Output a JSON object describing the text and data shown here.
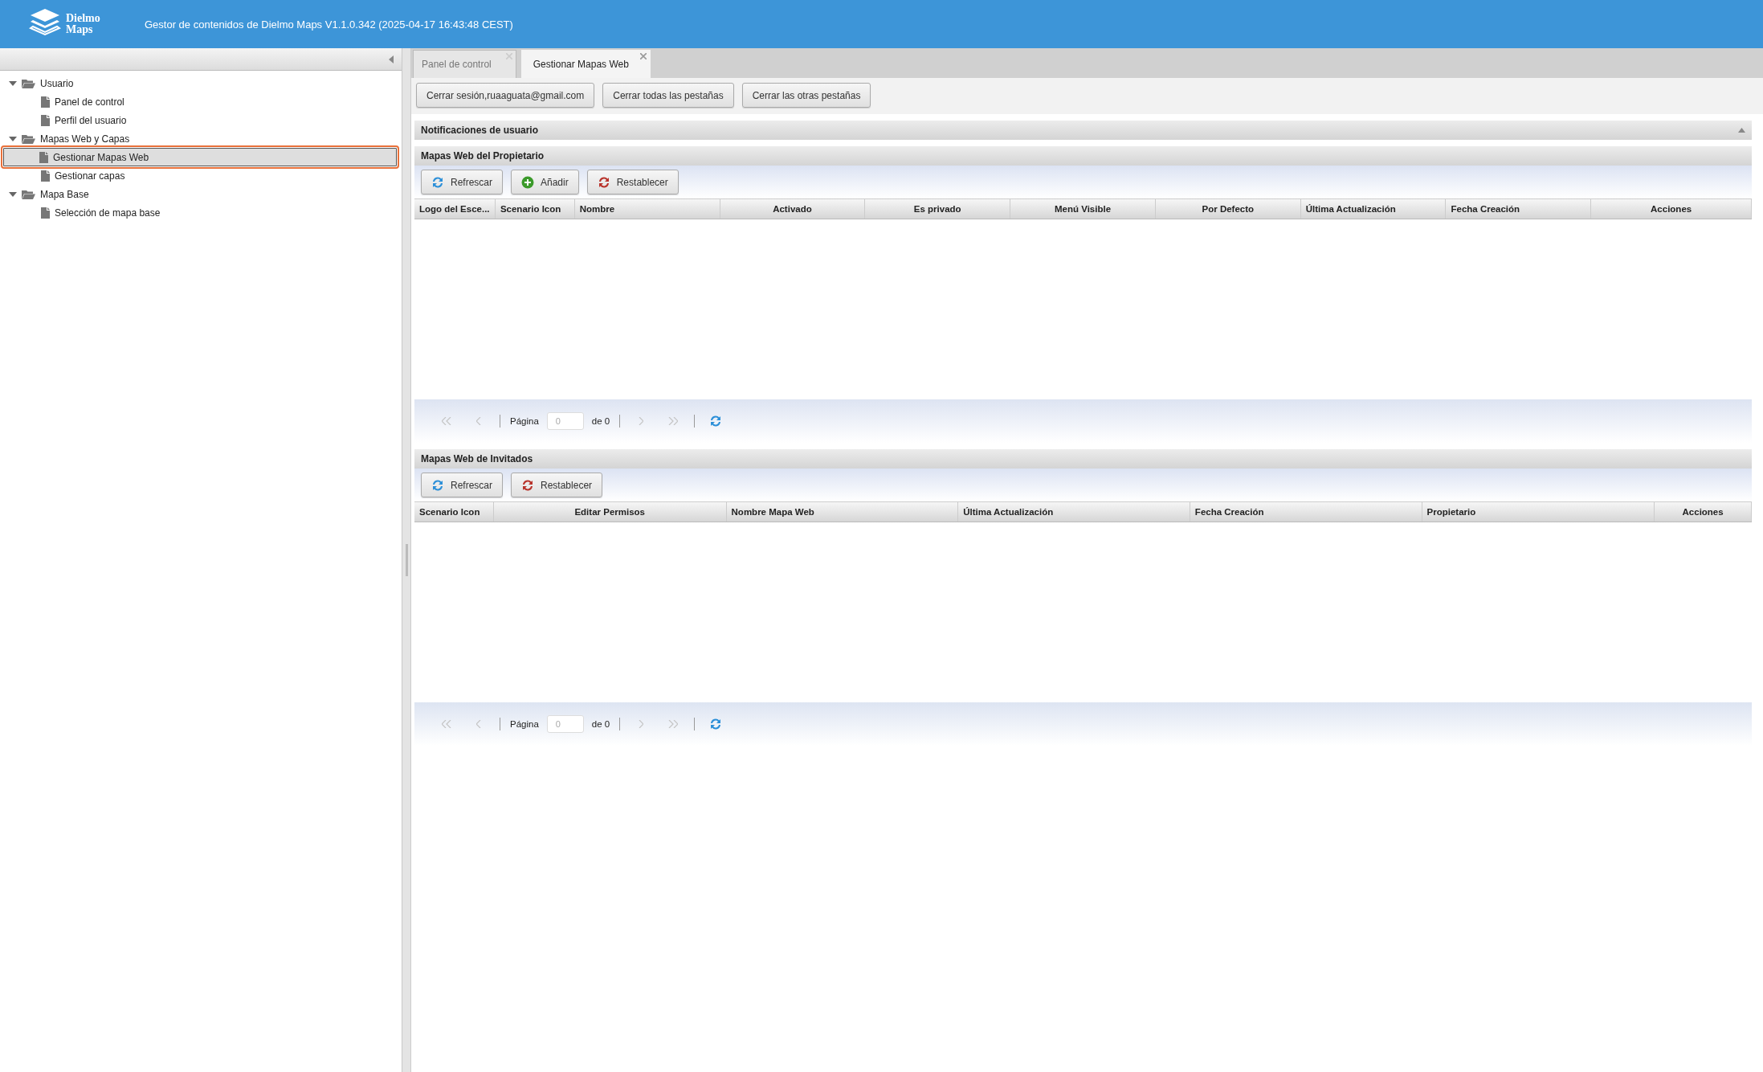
{
  "header": {
    "logo_text": "Dielmo Maps",
    "title": "Gestor de contenidos de Dielmo Maps V1.1.0.342 (2025-04-17 16:43:48 CEST)"
  },
  "sidebar": {
    "tree": [
      {
        "label": "Usuario",
        "expanded": true,
        "selected": false,
        "children": [
          {
            "label": "Panel de control",
            "selected": false
          },
          {
            "label": "Perfil del usuario",
            "selected": false
          }
        ]
      },
      {
        "label": "Mapas Web y Capas",
        "expanded": true,
        "selected": false,
        "children": [
          {
            "label": "Gestionar Mapas Web",
            "selected": true
          },
          {
            "label": "Gestionar capas",
            "selected": false
          }
        ]
      },
      {
        "label": "Mapa Base",
        "expanded": true,
        "selected": false,
        "children": [
          {
            "label": "Selección de mapa base",
            "selected": false
          }
        ]
      }
    ]
  },
  "tabs": [
    {
      "label": "Panel de control",
      "selected": false
    },
    {
      "label": "Gestionar Mapas Web",
      "selected": true
    }
  ],
  "session_buttons": [
    "Cerrar sesión,ruaaguata@gmail.com",
    "Cerrar todas las pestañas",
    "Cerrar las otras pestañas"
  ],
  "notifications_panel": {
    "title": "Notificaciones de usuario",
    "expanded": false
  },
  "grids": [
    {
      "title": "Mapas Web del Propietario",
      "buttons": [
        {
          "label": "Refrescar",
          "kind": "refresh"
        },
        {
          "label": "Añadir",
          "kind": "add"
        },
        {
          "label": "Restablecer",
          "kind": "reset"
        }
      ],
      "columns": [
        "Logo del Esce...",
        "Scenario Icon",
        "Nombre",
        "Activado",
        "Es privado",
        "Menú Visible",
        "Por Defecto",
        "Última Actualización",
        "Fecha Creación",
        "Acciones"
      ],
      "pager": {
        "page_label": "Página",
        "page_value": "0",
        "of_label": "de 0",
        "disabled": true
      }
    },
    {
      "title": "Mapas Web de Invitados",
      "buttons": [
        {
          "label": "Refrescar",
          "kind": "refresh"
        },
        {
          "label": "Restablecer",
          "kind": "reset"
        }
      ],
      "columns": [
        "Scenario Icon",
        "Editar Permisos",
        "Nombre Mapa Web",
        "Última Actualización",
        "Fecha Creación",
        "Propietario",
        "Acciones"
      ],
      "pager": {
        "page_label": "Página",
        "page_value": "0",
        "of_label": "de 0",
        "disabled": true
      }
    }
  ]
}
